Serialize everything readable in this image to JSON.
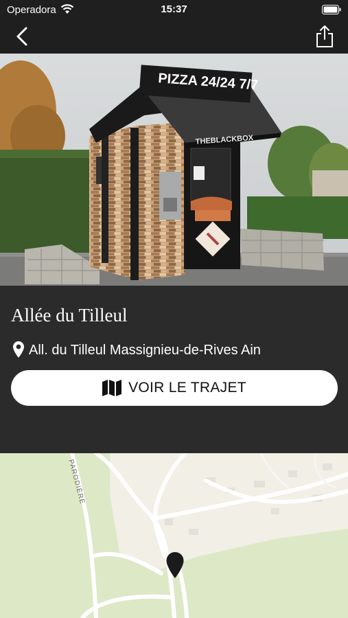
{
  "status_bar": {
    "carrier": "Operadora",
    "time": "15:37",
    "icons": [
      "wifi-icon",
      "battery-icon"
    ]
  },
  "nav": {
    "icons": [
      "back-chevron-icon",
      "share-icon"
    ]
  },
  "hero": {
    "kiosk_sign": "PIZZA  24/24 7/7",
    "brand_text": "THEBLACKBOX"
  },
  "place": {
    "title": "Allée du Tilleul",
    "address": "All. du Tilleul Massignieu-de-Rives Ain",
    "route_button_label": "VOIR LE TRAJET",
    "icons": [
      "location-pin-icon",
      "map-icon"
    ]
  },
  "map": {
    "road_label": "PARODIÈRE",
    "marker": "map-marker-icon"
  },
  "colors": {
    "background": "#2b2b2b",
    "bars": "#1f1f1f",
    "button": "#ffffff",
    "map_green": "#dde8c7",
    "map_sand": "#f1efe6"
  }
}
